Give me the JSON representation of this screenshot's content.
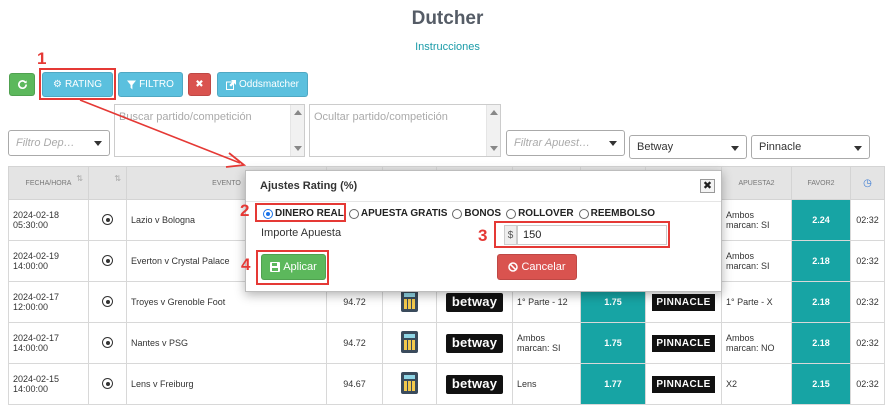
{
  "page": {
    "title": "Dutcher",
    "subtitle_link": "Instrucciones"
  },
  "toolbar": {
    "refresh_icon": "refresh-icon",
    "rating_label": "RATING",
    "filter_label": "FILTRO",
    "clear_icon": "close-icon",
    "oddsmatcher_label": "Oddsmatcher"
  },
  "filters": {
    "deporte_placeholder": "Filtro Dep…",
    "buscar_placeholder": "Buscar partido/competición",
    "ocultar_placeholder": "Ocultar partido/competición",
    "apuesta_placeholder": "Filtrar Apuest…",
    "bookmaker1": "Betway",
    "bookmaker2": "Pinnacle"
  },
  "table": {
    "headers": {
      "fecha": "FECHA/HORA",
      "evento": "EVENTO",
      "apuesta2": "APUESTA2",
      "favor2": "FAVOR2"
    },
    "rows": [
      {
        "date": "2024-02-18",
        "time": "05:30:00",
        "event": "Lazio v Bologna",
        "rating": "",
        "bet1": "",
        "favor1": "",
        "bet2_line1": "Ambos",
        "bet2_line2": "marcan: SI",
        "favor2": "2.24",
        "countdown": "02:32"
      },
      {
        "date": "2024-02-19",
        "time": "14:00:00",
        "event": "Everton v Crystal Palace",
        "rating": "",
        "bet1": "",
        "favor1": "",
        "bet2_line1": "Ambos",
        "bet2_line2": "marcan: SI",
        "favor2": "2.18",
        "countdown": "02:32"
      },
      {
        "date": "2024-02-17",
        "time": "12:00:00",
        "event": "Troyes v Grenoble Foot",
        "rating": "94.72",
        "bet1_line1": "1° Parte - 12",
        "bet1_line2": "",
        "bookmaker1": "betway",
        "favor1": "1.75",
        "bookmaker2": "PINNACLE",
        "bet2_line1": "1° Parte - X",
        "bet2_line2": "",
        "favor2": "2.18",
        "countdown": "02:32"
      },
      {
        "date": "2024-02-17",
        "time": "14:00:00",
        "event": "Nantes v PSG",
        "rating": "94.72",
        "bet1_line1": "Ambos",
        "bet1_line2": "marcan: SI",
        "bookmaker1": "betway",
        "favor1": "1.75",
        "bookmaker2": "PINNACLE",
        "bet2_line1": "Ambos",
        "bet2_line2": "marcan: NO",
        "favor2": "2.18",
        "countdown": "02:32"
      },
      {
        "date": "2024-02-15",
        "time": "14:00:00",
        "event": "Lens v Freiburg",
        "rating": "94.67",
        "bet1_line1": "Lens",
        "bet1_line2": "",
        "bookmaker1": "betway",
        "favor1": "1.77",
        "bookmaker2": "PINNACLE",
        "bet2_line1": "X2",
        "bet2_line2": "",
        "favor2": "2.15",
        "countdown": "02:32"
      }
    ]
  },
  "modal": {
    "title": "Ajustes Rating (%)",
    "options": [
      "DINERO REAL",
      "APUESTA GRATIS",
      "BONOS",
      "ROLLOVER",
      "REEMBOLSO"
    ],
    "selected_option": "DINERO REAL",
    "amount_label": "Importe Apuesta",
    "currency": "$",
    "amount_value": "150",
    "apply_label": "Aplicar",
    "cancel_label": "Cancelar"
  },
  "annotations": {
    "step1": "1",
    "step2": "2",
    "step3": "3",
    "step4": "4"
  },
  "colors": {
    "teal": "#17a4a4",
    "annotation_red": "#e53935",
    "green": "#5cb85c",
    "blue": "#5bc0de",
    "red": "#d9534f"
  }
}
